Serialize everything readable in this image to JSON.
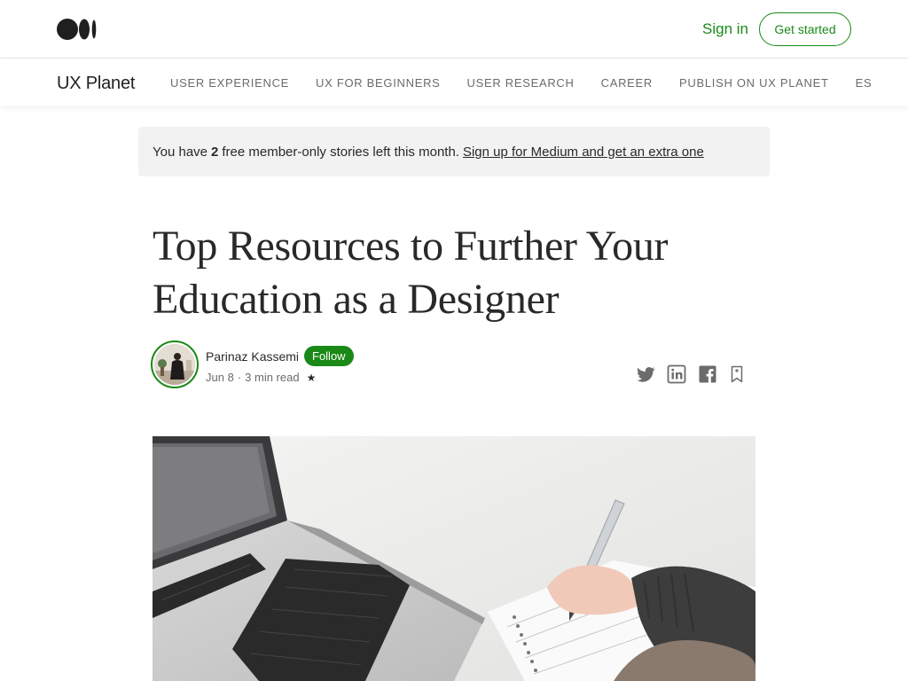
{
  "header": {
    "signin_label": "Sign in",
    "get_started_label": "Get started"
  },
  "publication": {
    "name": "UX Planet",
    "nav": [
      "USER EXPERIENCE",
      "UX FOR BEGINNERS",
      "USER RESEARCH",
      "CAREER",
      "PUBLISH ON UX PLANET",
      "ES"
    ]
  },
  "banner": {
    "prefix": "You have",
    "count": "2",
    "suffix": "free member-only stories left this month.",
    "link": "Sign up for Medium and get an extra one"
  },
  "article": {
    "title_line1": "Top Resources to Further Your",
    "title_line2": "Education as a Designer",
    "author": "Parinaz Kassemi",
    "follow_label": "Follow",
    "date": "Jun 8",
    "separator": "·",
    "read_time": "3 min read",
    "member_star": "★"
  },
  "share_icons": [
    "twitter-icon",
    "linkedin-icon",
    "facebook-icon",
    "bookmark-icon"
  ],
  "colors": {
    "accent": "#1a8917",
    "text": "#292929",
    "muted": "#6b6b6b",
    "banner_bg": "#f2f2f2"
  }
}
